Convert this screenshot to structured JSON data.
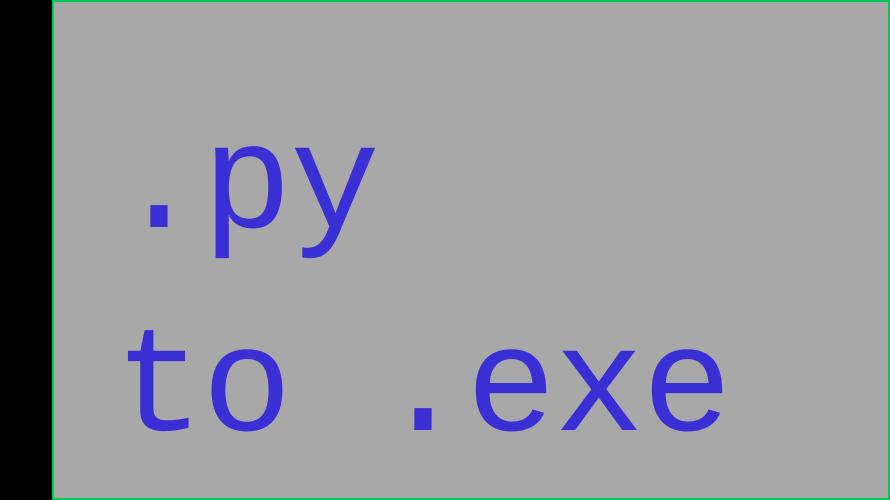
{
  "content": {
    "line1": ".py",
    "line2": "to .exe"
  }
}
